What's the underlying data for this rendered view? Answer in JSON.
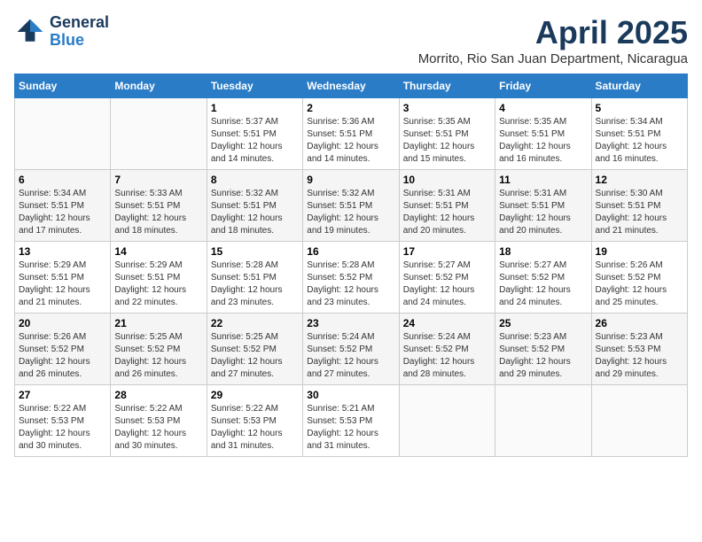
{
  "header": {
    "logo_line1": "General",
    "logo_line2": "Blue",
    "month_title": "April 2025",
    "location": "Morrito, Rio San Juan Department, Nicaragua"
  },
  "weekdays": [
    "Sunday",
    "Monday",
    "Tuesday",
    "Wednesday",
    "Thursday",
    "Friday",
    "Saturday"
  ],
  "weeks": [
    [
      {
        "day": "",
        "text": ""
      },
      {
        "day": "",
        "text": ""
      },
      {
        "day": "1",
        "text": "Sunrise: 5:37 AM\nSunset: 5:51 PM\nDaylight: 12 hours and 14 minutes."
      },
      {
        "day": "2",
        "text": "Sunrise: 5:36 AM\nSunset: 5:51 PM\nDaylight: 12 hours and 14 minutes."
      },
      {
        "day": "3",
        "text": "Sunrise: 5:35 AM\nSunset: 5:51 PM\nDaylight: 12 hours and 15 minutes."
      },
      {
        "day": "4",
        "text": "Sunrise: 5:35 AM\nSunset: 5:51 PM\nDaylight: 12 hours and 16 minutes."
      },
      {
        "day": "5",
        "text": "Sunrise: 5:34 AM\nSunset: 5:51 PM\nDaylight: 12 hours and 16 minutes."
      }
    ],
    [
      {
        "day": "6",
        "text": "Sunrise: 5:34 AM\nSunset: 5:51 PM\nDaylight: 12 hours and 17 minutes."
      },
      {
        "day": "7",
        "text": "Sunrise: 5:33 AM\nSunset: 5:51 PM\nDaylight: 12 hours and 18 minutes."
      },
      {
        "day": "8",
        "text": "Sunrise: 5:32 AM\nSunset: 5:51 PM\nDaylight: 12 hours and 18 minutes."
      },
      {
        "day": "9",
        "text": "Sunrise: 5:32 AM\nSunset: 5:51 PM\nDaylight: 12 hours and 19 minutes."
      },
      {
        "day": "10",
        "text": "Sunrise: 5:31 AM\nSunset: 5:51 PM\nDaylight: 12 hours and 20 minutes."
      },
      {
        "day": "11",
        "text": "Sunrise: 5:31 AM\nSunset: 5:51 PM\nDaylight: 12 hours and 20 minutes."
      },
      {
        "day": "12",
        "text": "Sunrise: 5:30 AM\nSunset: 5:51 PM\nDaylight: 12 hours and 21 minutes."
      }
    ],
    [
      {
        "day": "13",
        "text": "Sunrise: 5:29 AM\nSunset: 5:51 PM\nDaylight: 12 hours and 21 minutes."
      },
      {
        "day": "14",
        "text": "Sunrise: 5:29 AM\nSunset: 5:51 PM\nDaylight: 12 hours and 22 minutes."
      },
      {
        "day": "15",
        "text": "Sunrise: 5:28 AM\nSunset: 5:51 PM\nDaylight: 12 hours and 23 minutes."
      },
      {
        "day": "16",
        "text": "Sunrise: 5:28 AM\nSunset: 5:52 PM\nDaylight: 12 hours and 23 minutes."
      },
      {
        "day": "17",
        "text": "Sunrise: 5:27 AM\nSunset: 5:52 PM\nDaylight: 12 hours and 24 minutes."
      },
      {
        "day": "18",
        "text": "Sunrise: 5:27 AM\nSunset: 5:52 PM\nDaylight: 12 hours and 24 minutes."
      },
      {
        "day": "19",
        "text": "Sunrise: 5:26 AM\nSunset: 5:52 PM\nDaylight: 12 hours and 25 minutes."
      }
    ],
    [
      {
        "day": "20",
        "text": "Sunrise: 5:26 AM\nSunset: 5:52 PM\nDaylight: 12 hours and 26 minutes."
      },
      {
        "day": "21",
        "text": "Sunrise: 5:25 AM\nSunset: 5:52 PM\nDaylight: 12 hours and 26 minutes."
      },
      {
        "day": "22",
        "text": "Sunrise: 5:25 AM\nSunset: 5:52 PM\nDaylight: 12 hours and 27 minutes."
      },
      {
        "day": "23",
        "text": "Sunrise: 5:24 AM\nSunset: 5:52 PM\nDaylight: 12 hours and 27 minutes."
      },
      {
        "day": "24",
        "text": "Sunrise: 5:24 AM\nSunset: 5:52 PM\nDaylight: 12 hours and 28 minutes."
      },
      {
        "day": "25",
        "text": "Sunrise: 5:23 AM\nSunset: 5:52 PM\nDaylight: 12 hours and 29 minutes."
      },
      {
        "day": "26",
        "text": "Sunrise: 5:23 AM\nSunset: 5:53 PM\nDaylight: 12 hours and 29 minutes."
      }
    ],
    [
      {
        "day": "27",
        "text": "Sunrise: 5:22 AM\nSunset: 5:53 PM\nDaylight: 12 hours and 30 minutes."
      },
      {
        "day": "28",
        "text": "Sunrise: 5:22 AM\nSunset: 5:53 PM\nDaylight: 12 hours and 30 minutes."
      },
      {
        "day": "29",
        "text": "Sunrise: 5:22 AM\nSunset: 5:53 PM\nDaylight: 12 hours and 31 minutes."
      },
      {
        "day": "30",
        "text": "Sunrise: 5:21 AM\nSunset: 5:53 PM\nDaylight: 12 hours and 31 minutes."
      },
      {
        "day": "",
        "text": ""
      },
      {
        "day": "",
        "text": ""
      },
      {
        "day": "",
        "text": ""
      }
    ]
  ]
}
